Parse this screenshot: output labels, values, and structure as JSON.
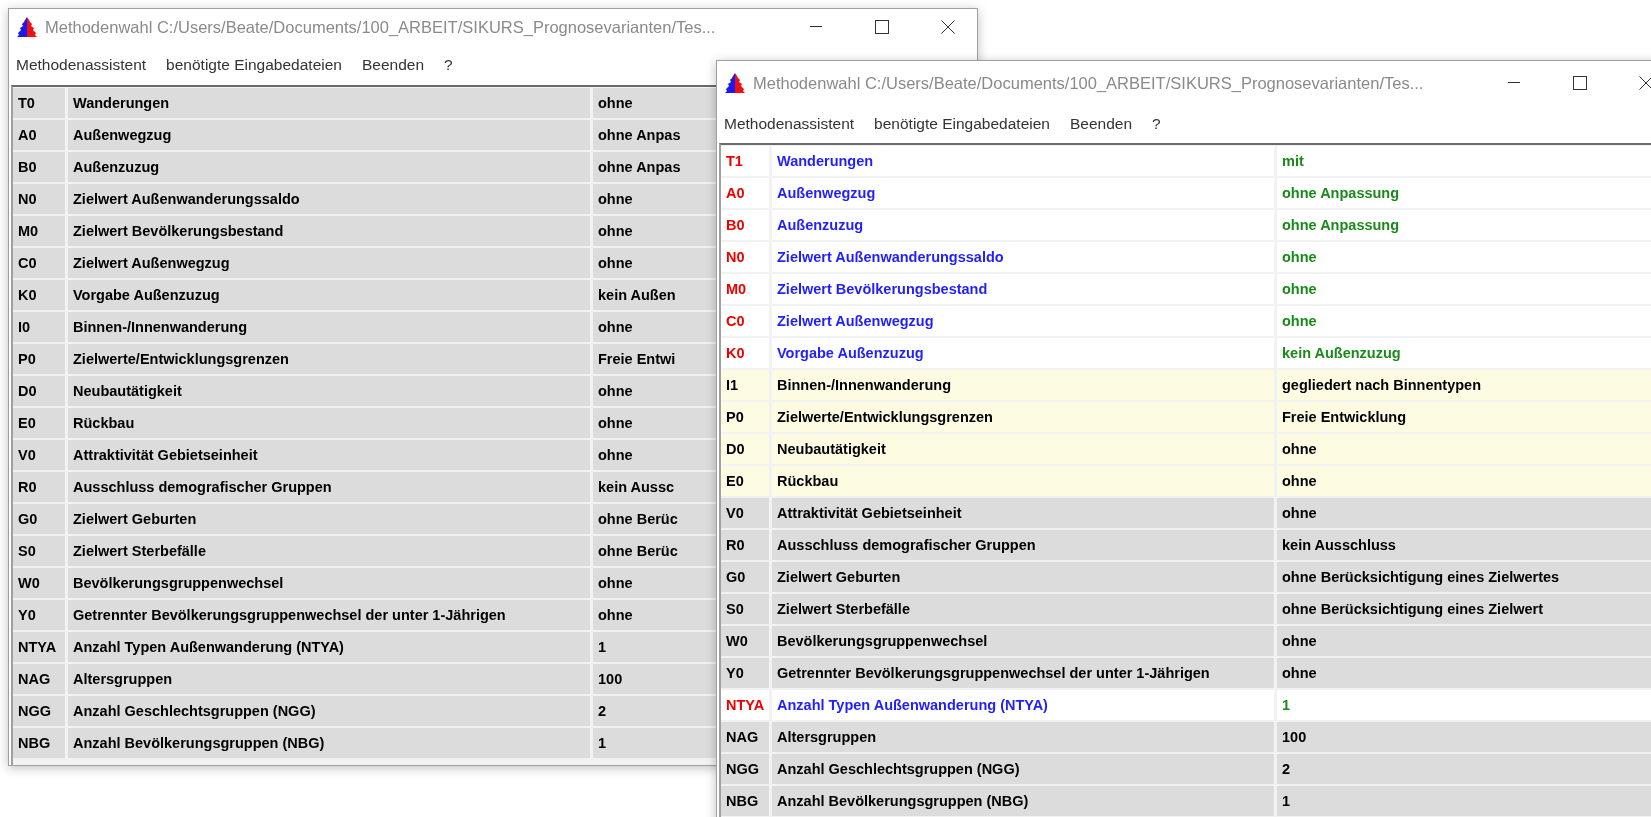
{
  "windows": [
    {
      "title": "Methodenwahl C:/Users/Beate/Documents/100_ARBEIT/SIKURS_Prognosevarianten/Tes...",
      "menu": [
        "Methodenassistent",
        "benötigte Eingabedateien",
        "Beenden",
        "?"
      ],
      "rows": [
        {
          "code": "T0",
          "name": "Wanderungen",
          "value": "ohne",
          "kind": "plain"
        },
        {
          "code": "A0",
          "name": "Außenwegzug",
          "value": "ohne Anpas",
          "kind": "plain"
        },
        {
          "code": "B0",
          "name": "Außenzuzug",
          "value": "ohne Anpas",
          "kind": "plain"
        },
        {
          "code": "N0",
          "name": "Zielwert Außenwanderungssaldo",
          "value": "ohne",
          "kind": "plain"
        },
        {
          "code": "M0",
          "name": "Zielwert Bevölkerungsbestand",
          "value": "ohne",
          "kind": "plain"
        },
        {
          "code": "C0",
          "name": "Zielwert Außenwegzug",
          "value": "ohne",
          "kind": "plain"
        },
        {
          "code": "K0",
          "name": "Vorgabe Außenzuzug",
          "value": "kein Außen",
          "kind": "plain"
        },
        {
          "code": "I0",
          "name": "Binnen-/Innenwanderung",
          "value": "ohne",
          "kind": "plain"
        },
        {
          "code": "P0",
          "name": "Zielwerte/Entwicklungsgrenzen",
          "value": "Freie Entwi",
          "kind": "plain"
        },
        {
          "code": "D0",
          "name": "Neubautätigkeit",
          "value": "ohne",
          "kind": "plain"
        },
        {
          "code": "E0",
          "name": "Rückbau",
          "value": "ohne",
          "kind": "plain"
        },
        {
          "code": "V0",
          "name": "Attraktivität Gebietseinheit",
          "value": "ohne",
          "kind": "plain"
        },
        {
          "code": "R0",
          "name": "Ausschluss demografischer Gruppen",
          "value": "kein Aussc",
          "kind": "plain"
        },
        {
          "code": "G0",
          "name": "Zielwert Geburten",
          "value": "ohne Berüc",
          "kind": "plain"
        },
        {
          "code": "S0",
          "name": "Zielwert Sterbefälle",
          "value": "ohne Berüc",
          "kind": "plain"
        },
        {
          "code": "W0",
          "name": "Bevölkerungsgruppenwechsel",
          "value": "ohne",
          "kind": "plain"
        },
        {
          "code": "Y0",
          "name": "Getrennter Bevölkerungsgruppenwechsel der unter 1-Jährigen",
          "value": "ohne",
          "kind": "plain"
        },
        {
          "code": "NTYA",
          "name": "Anzahl Typen Außenwanderung (NTYA)",
          "value": "1",
          "kind": "plain"
        },
        {
          "code": "NAG",
          "name": "Altersgruppen",
          "value": "100",
          "kind": "plain"
        },
        {
          "code": "NGG",
          "name": "Anzahl Geschlechtsgruppen (NGG)",
          "value": "2",
          "kind": "plain"
        },
        {
          "code": "NBG",
          "name": "Anzahl Bevölkerungsgruppen (NBG)",
          "value": "1",
          "kind": "plain"
        }
      ]
    },
    {
      "title": "Methodenwahl C:/Users/Beate/Documents/100_ARBEIT/SIKURS_Prognosevarianten/Tes...",
      "menu": [
        "Methodenassistent",
        "benötigte Eingabedateien",
        "Beenden",
        "?"
      ],
      "rows": [
        {
          "code": "T1",
          "name": "Wanderungen",
          "value": "mit",
          "kind": "changed"
        },
        {
          "code": "A0",
          "name": "Außenwegzug",
          "value": "ohne Anpassung",
          "kind": "changed"
        },
        {
          "code": "B0",
          "name": "Außenzuzug",
          "value": "ohne Anpassung",
          "kind": "changed"
        },
        {
          "code": "N0",
          "name": "Zielwert Außenwanderungssaldo",
          "value": "ohne",
          "kind": "changed"
        },
        {
          "code": "M0",
          "name": "Zielwert Bevölkerungsbestand",
          "value": "ohne",
          "kind": "changed"
        },
        {
          "code": "C0",
          "name": "Zielwert Außenwegzug",
          "value": "ohne",
          "kind": "changed"
        },
        {
          "code": "K0",
          "name": "Vorgabe Außenzuzug",
          "value": "kein Außenzuzug",
          "kind": "changed"
        },
        {
          "code": "I1",
          "name": "Binnen-/Innenwanderung",
          "value": "gegliedert nach Binnentypen",
          "kind": "dependent"
        },
        {
          "code": "P0",
          "name": "Zielwerte/Entwicklungsgrenzen",
          "value": "Freie Entwicklung",
          "kind": "dependent"
        },
        {
          "code": "D0",
          "name": "Neubautätigkeit",
          "value": "ohne",
          "kind": "dependent"
        },
        {
          "code": "E0",
          "name": "Rückbau",
          "value": "ohne",
          "kind": "dependent"
        },
        {
          "code": "V0",
          "name": "Attraktivität Gebietseinheit",
          "value": "ohne",
          "kind": "plain"
        },
        {
          "code": "R0",
          "name": "Ausschluss demografischer Gruppen",
          "value": "kein Ausschluss",
          "kind": "plain"
        },
        {
          "code": "G0",
          "name": "Zielwert Geburten",
          "value": "ohne Berücksichtigung eines Zielwertes",
          "kind": "plain"
        },
        {
          "code": "S0",
          "name": "Zielwert Sterbefälle",
          "value": "ohne Berücksichtigung eines Zielwert",
          "kind": "plain"
        },
        {
          "code": "W0",
          "name": "Bevölkerungsgruppenwechsel",
          "value": "ohne",
          "kind": "plain"
        },
        {
          "code": "Y0",
          "name": "Getrennter Bevölkerungsgruppenwechsel der unter 1-Jährigen",
          "value": "ohne",
          "kind": "plain"
        },
        {
          "code": "NTYA",
          "name": "Anzahl Typen Außenwanderung (NTYA)",
          "value": "1",
          "kind": "changed"
        },
        {
          "code": "NAG",
          "name": "Altersgruppen",
          "value": "100",
          "kind": "plain"
        },
        {
          "code": "NGG",
          "name": "Anzahl Geschlechtsgruppen (NGG)",
          "value": "2",
          "kind": "plain"
        },
        {
          "code": "NBG",
          "name": "Anzahl Bevölkerungsgruppen (NBG)",
          "value": "1",
          "kind": "plain"
        }
      ]
    }
  ]
}
